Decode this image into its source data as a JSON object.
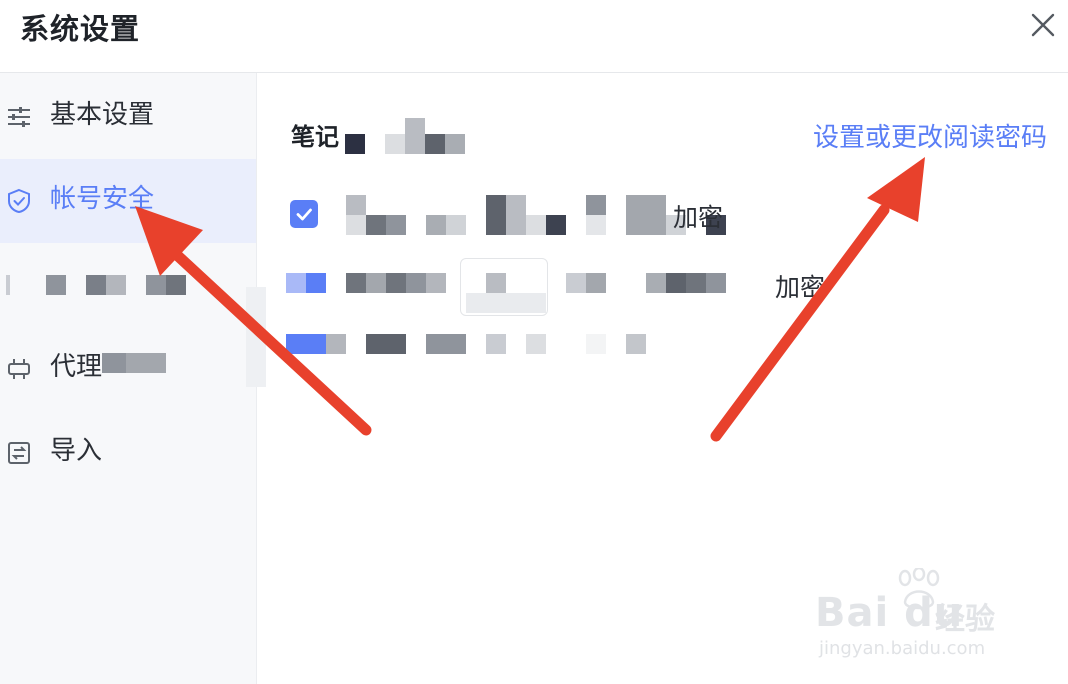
{
  "dialog": {
    "title": "系统设置"
  },
  "sidebar": {
    "items": [
      {
        "label": "基本设置",
        "icon": "sliders-icon",
        "active": false
      },
      {
        "label": "帐号安全",
        "icon": "shield-icon",
        "active": true
      },
      {
        "label": "",
        "icon": "",
        "active": false
      },
      {
        "label": "代理",
        "icon": "plug-icon",
        "active": false
      },
      {
        "label": "导入",
        "icon": "import-icon",
        "active": false
      }
    ]
  },
  "main": {
    "section_title": "笔记",
    "set_password_link": "设置或更改阅读密码",
    "option1_suffix": "加密",
    "option2_suffix": "加密"
  },
  "watermark": {
    "brand": "Bai du",
    "brand_cn": "经验",
    "url": "jingyan.baidu.com"
  },
  "colors": {
    "accent": "#5a7ef6",
    "annotation_arrow": "#e8412c",
    "active_bg": "#eaeefc"
  }
}
